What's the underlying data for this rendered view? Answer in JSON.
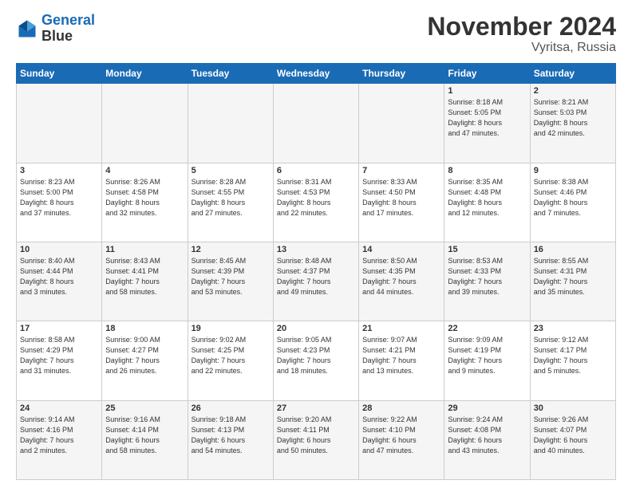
{
  "logo": {
    "line1": "General",
    "line2": "Blue"
  },
  "title": "November 2024",
  "subtitle": "Vyritsa, Russia",
  "weekdays": [
    "Sunday",
    "Monday",
    "Tuesday",
    "Wednesday",
    "Thursday",
    "Friday",
    "Saturday"
  ],
  "weeks": [
    [
      {
        "day": "",
        "info": ""
      },
      {
        "day": "",
        "info": ""
      },
      {
        "day": "",
        "info": ""
      },
      {
        "day": "",
        "info": ""
      },
      {
        "day": "",
        "info": ""
      },
      {
        "day": "1",
        "info": "Sunrise: 8:18 AM\nSunset: 5:05 PM\nDaylight: 8 hours\nand 47 minutes."
      },
      {
        "day": "2",
        "info": "Sunrise: 8:21 AM\nSunset: 5:03 PM\nDaylight: 8 hours\nand 42 minutes."
      }
    ],
    [
      {
        "day": "3",
        "info": "Sunrise: 8:23 AM\nSunset: 5:00 PM\nDaylight: 8 hours\nand 37 minutes."
      },
      {
        "day": "4",
        "info": "Sunrise: 8:26 AM\nSunset: 4:58 PM\nDaylight: 8 hours\nand 32 minutes."
      },
      {
        "day": "5",
        "info": "Sunrise: 8:28 AM\nSunset: 4:55 PM\nDaylight: 8 hours\nand 27 minutes."
      },
      {
        "day": "6",
        "info": "Sunrise: 8:31 AM\nSunset: 4:53 PM\nDaylight: 8 hours\nand 22 minutes."
      },
      {
        "day": "7",
        "info": "Sunrise: 8:33 AM\nSunset: 4:50 PM\nDaylight: 8 hours\nand 17 minutes."
      },
      {
        "day": "8",
        "info": "Sunrise: 8:35 AM\nSunset: 4:48 PM\nDaylight: 8 hours\nand 12 minutes."
      },
      {
        "day": "9",
        "info": "Sunrise: 8:38 AM\nSunset: 4:46 PM\nDaylight: 8 hours\nand 7 minutes."
      }
    ],
    [
      {
        "day": "10",
        "info": "Sunrise: 8:40 AM\nSunset: 4:44 PM\nDaylight: 8 hours\nand 3 minutes."
      },
      {
        "day": "11",
        "info": "Sunrise: 8:43 AM\nSunset: 4:41 PM\nDaylight: 7 hours\nand 58 minutes."
      },
      {
        "day": "12",
        "info": "Sunrise: 8:45 AM\nSunset: 4:39 PM\nDaylight: 7 hours\nand 53 minutes."
      },
      {
        "day": "13",
        "info": "Sunrise: 8:48 AM\nSunset: 4:37 PM\nDaylight: 7 hours\nand 49 minutes."
      },
      {
        "day": "14",
        "info": "Sunrise: 8:50 AM\nSunset: 4:35 PM\nDaylight: 7 hours\nand 44 minutes."
      },
      {
        "day": "15",
        "info": "Sunrise: 8:53 AM\nSunset: 4:33 PM\nDaylight: 7 hours\nand 39 minutes."
      },
      {
        "day": "16",
        "info": "Sunrise: 8:55 AM\nSunset: 4:31 PM\nDaylight: 7 hours\nand 35 minutes."
      }
    ],
    [
      {
        "day": "17",
        "info": "Sunrise: 8:58 AM\nSunset: 4:29 PM\nDaylight: 7 hours\nand 31 minutes."
      },
      {
        "day": "18",
        "info": "Sunrise: 9:00 AM\nSunset: 4:27 PM\nDaylight: 7 hours\nand 26 minutes."
      },
      {
        "day": "19",
        "info": "Sunrise: 9:02 AM\nSunset: 4:25 PM\nDaylight: 7 hours\nand 22 minutes."
      },
      {
        "day": "20",
        "info": "Sunrise: 9:05 AM\nSunset: 4:23 PM\nDaylight: 7 hours\nand 18 minutes."
      },
      {
        "day": "21",
        "info": "Sunrise: 9:07 AM\nSunset: 4:21 PM\nDaylight: 7 hours\nand 13 minutes."
      },
      {
        "day": "22",
        "info": "Sunrise: 9:09 AM\nSunset: 4:19 PM\nDaylight: 7 hours\nand 9 minutes."
      },
      {
        "day": "23",
        "info": "Sunrise: 9:12 AM\nSunset: 4:17 PM\nDaylight: 7 hours\nand 5 minutes."
      }
    ],
    [
      {
        "day": "24",
        "info": "Sunrise: 9:14 AM\nSunset: 4:16 PM\nDaylight: 7 hours\nand 2 minutes."
      },
      {
        "day": "25",
        "info": "Sunrise: 9:16 AM\nSunset: 4:14 PM\nDaylight: 6 hours\nand 58 minutes."
      },
      {
        "day": "26",
        "info": "Sunrise: 9:18 AM\nSunset: 4:13 PM\nDaylight: 6 hours\nand 54 minutes."
      },
      {
        "day": "27",
        "info": "Sunrise: 9:20 AM\nSunset: 4:11 PM\nDaylight: 6 hours\nand 50 minutes."
      },
      {
        "day": "28",
        "info": "Sunrise: 9:22 AM\nSunset: 4:10 PM\nDaylight: 6 hours\nand 47 minutes."
      },
      {
        "day": "29",
        "info": "Sunrise: 9:24 AM\nSunset: 4:08 PM\nDaylight: 6 hours\nand 43 minutes."
      },
      {
        "day": "30",
        "info": "Sunrise: 9:26 AM\nSunset: 4:07 PM\nDaylight: 6 hours\nand 40 minutes."
      }
    ]
  ]
}
